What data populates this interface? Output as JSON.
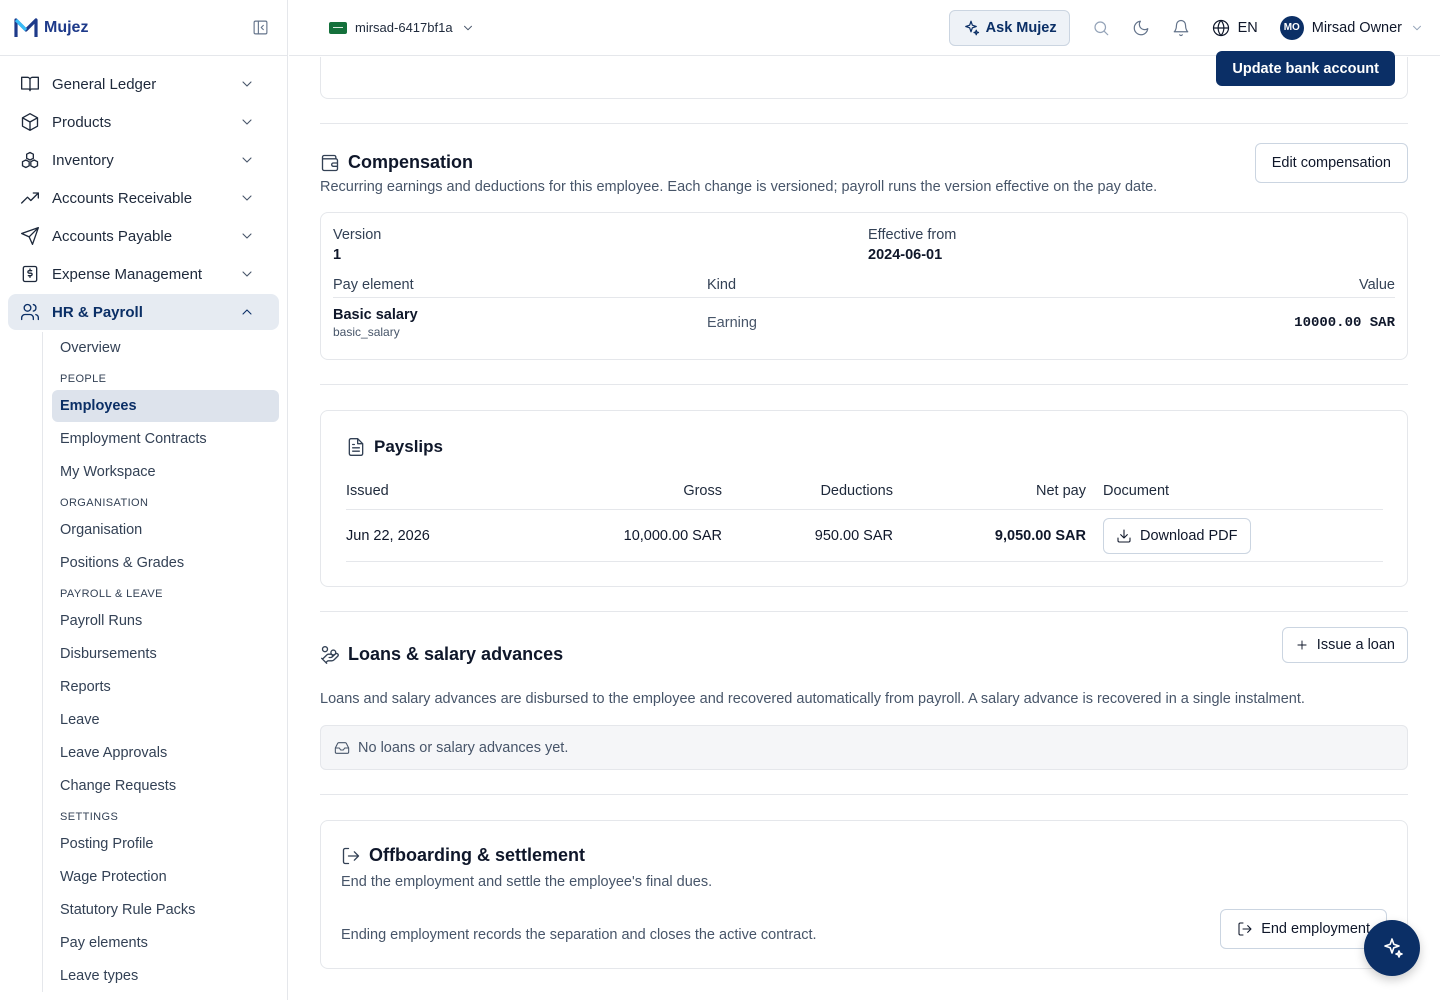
{
  "app": {
    "name": "Mujez"
  },
  "sidebar": {
    "items": [
      {
        "label": "General Ledger",
        "icon": "book-icon"
      },
      {
        "label": "Products",
        "icon": "box-icon"
      },
      {
        "label": "Inventory",
        "icon": "boxes-icon"
      },
      {
        "label": "Accounts Receivable",
        "icon": "trend-icon"
      },
      {
        "label": "Accounts Payable",
        "icon": "send-icon"
      },
      {
        "label": "Expense Management",
        "icon": "receipt-icon"
      },
      {
        "label": "HR & Payroll",
        "icon": "users-icon"
      }
    ],
    "hr": {
      "overview": "Overview",
      "groups": {
        "people": "PEOPLE",
        "organisation": "ORGANISATION",
        "payroll": "PAYROLL & LEAVE",
        "settings": "SETTINGS"
      },
      "people": [
        "Employees",
        "Employment Contracts",
        "My Workspace"
      ],
      "organisation": [
        "Organisation",
        "Positions & Grades"
      ],
      "payroll": [
        "Payroll Runs",
        "Disbursements",
        "Reports",
        "Leave",
        "Leave Approvals",
        "Change Requests"
      ],
      "settings": [
        "Posting Profile",
        "Wage Protection",
        "Statutory Rule Packs",
        "Pay elements",
        "Leave types"
      ]
    }
  },
  "topbar": {
    "tenant": "mirsad-6417bf1a",
    "ask": "Ask Mujez",
    "lang": "EN",
    "avatar": "MO",
    "user": "Mirsad Owner"
  },
  "bank": {
    "button": "Update bank account"
  },
  "compensation": {
    "title": "Compensation",
    "desc": "Recurring earnings and deductions for this employee. Each change is versioned; payroll runs the version effective on the pay date.",
    "button": "Edit compensation",
    "version_label": "Version",
    "version": "1",
    "effective_label": "Effective from",
    "effective": "2024-06-01",
    "headers": {
      "element": "Pay element",
      "kind": "Kind",
      "value": "Value"
    },
    "rows": [
      {
        "name": "Basic salary",
        "code": "basic_salary",
        "kind": "Earning",
        "value": "10000.00 SAR"
      }
    ]
  },
  "payslips": {
    "title": "Payslips",
    "headers": {
      "issued": "Issued",
      "gross": "Gross",
      "deductions": "Deductions",
      "net": "Net pay",
      "document": "Document"
    },
    "rows": [
      {
        "issued": "Jun 22, 2026",
        "gross": "10,000.00 SAR",
        "deductions": "950.00 SAR",
        "net": "9,050.00 SAR",
        "action": "Download PDF"
      }
    ]
  },
  "loans": {
    "title": "Loans & salary advances",
    "button": "Issue a loan",
    "desc": "Loans and salary advances are disbursed to the employee and recovered automatically from payroll. A salary advance is recovered in a single instalment.",
    "empty": "No loans or salary advances yet."
  },
  "offboarding": {
    "title": "Offboarding & settlement",
    "desc": "End the employment and settle the employee's final dues.",
    "note": "Ending employment records the separation and closes the active contract.",
    "button": "End employment"
  }
}
